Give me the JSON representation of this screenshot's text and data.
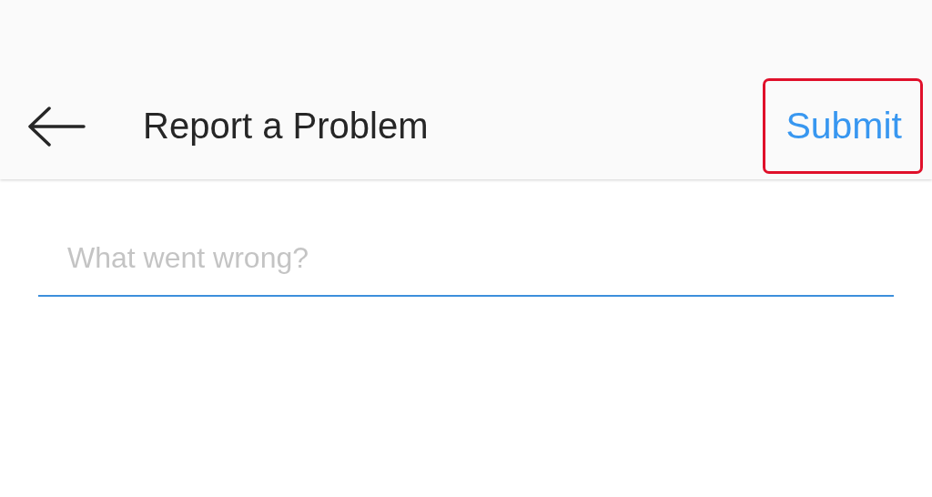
{
  "header": {
    "title": "Report a Problem",
    "submit": {
      "label": "Submit",
      "highlighted": true
    }
  },
  "form": {
    "placeholder": "What went wrong?"
  }
}
